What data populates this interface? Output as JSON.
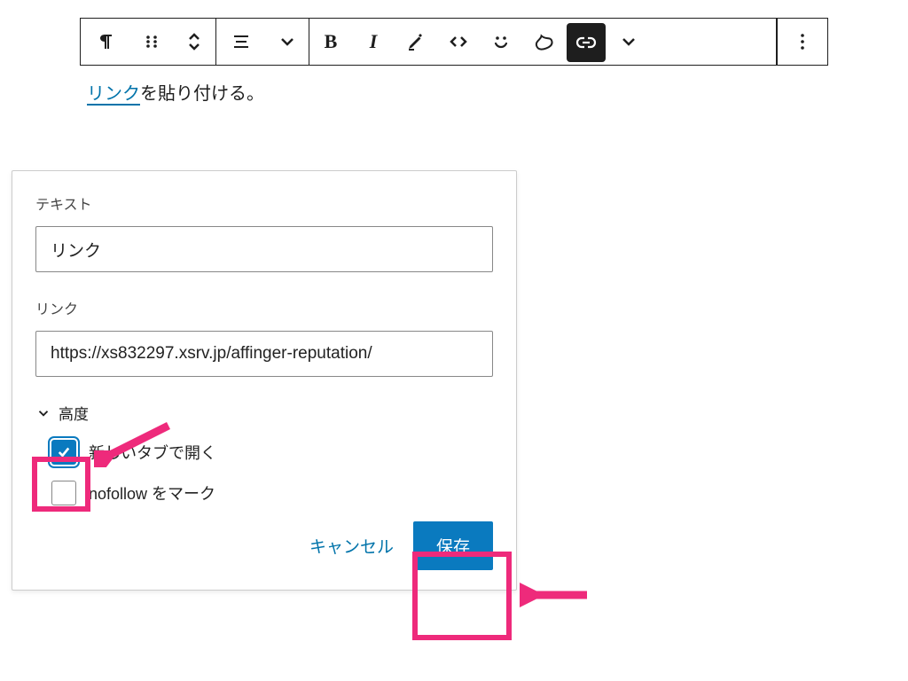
{
  "content": {
    "link_word": "リンク",
    "rest": "を貼り付ける。"
  },
  "popover": {
    "text_label": "テキスト",
    "text_value": "リンク",
    "link_label": "リンク",
    "link_value": "https://xs832297.xsrv.jp/affinger-reputation/",
    "advanced_label": "高度",
    "newtab_label": "新しいタブで開く",
    "nofollow_label": "nofollow をマーク",
    "cancel": "キャンセル",
    "save": "保存"
  },
  "toolbar": {
    "bold": "B",
    "italic": "I"
  }
}
